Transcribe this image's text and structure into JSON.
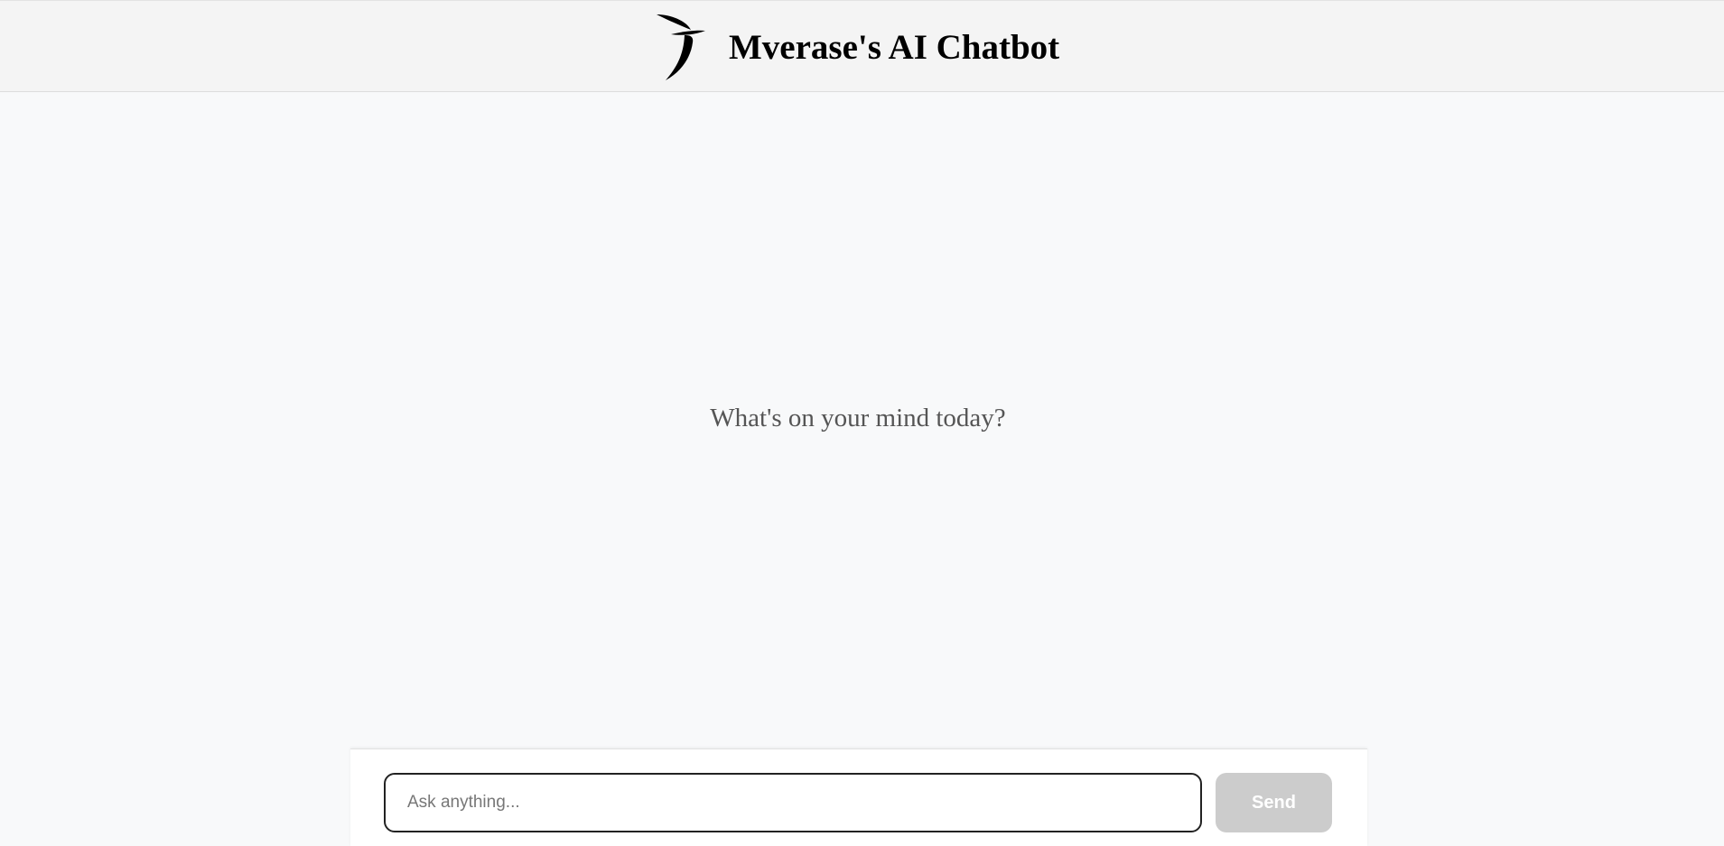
{
  "header": {
    "logo_icon": "stylized-j-brushstroke-logo-icon",
    "title": "Mverase's AI Chatbot"
  },
  "main": {
    "welcome_text": "What's on your mind today?"
  },
  "composer": {
    "input_value": "",
    "input_placeholder": "Ask anything...",
    "send_label": "Send"
  },
  "colors": {
    "header_background": "#f4f4f4",
    "page_background": "#f8f9fa",
    "send_button_disabled": "#cccccc",
    "input_border": "#222222"
  }
}
